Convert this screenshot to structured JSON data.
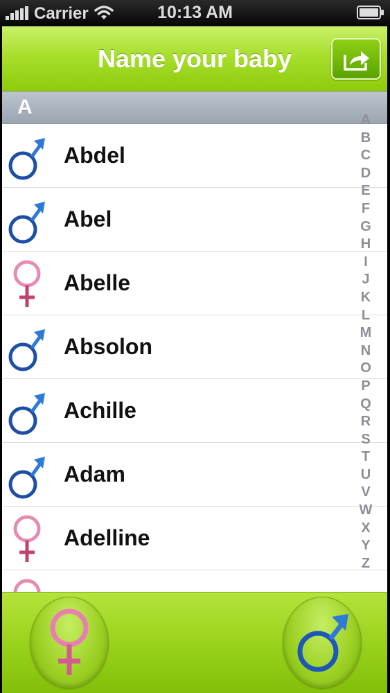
{
  "status_bar": {
    "carrier": "Carrier",
    "time": "10:13 AM",
    "icons": [
      "signal-bars-icon",
      "wifi-icon",
      "battery-icon"
    ]
  },
  "nav_bar": {
    "title": "Name your baby",
    "share_button_icon": "share-icon"
  },
  "section": {
    "letter": "A"
  },
  "names": [
    {
      "name": "Abdel",
      "gender": "male"
    },
    {
      "name": "Abel",
      "gender": "male"
    },
    {
      "name": "Abelle",
      "gender": "female"
    },
    {
      "name": "Absolon",
      "gender": "male"
    },
    {
      "name": "Achille",
      "gender": "male"
    },
    {
      "name": "Adam",
      "gender": "male"
    },
    {
      "name": "Adelline",
      "gender": "female"
    },
    {
      "name": "",
      "gender": "female"
    }
  ],
  "index": [
    "A",
    "B",
    "C",
    "D",
    "E",
    "F",
    "G",
    "H",
    "I",
    "J",
    "K",
    "L",
    "M",
    "N",
    "O",
    "P",
    "Q",
    "R",
    "S",
    "T",
    "U",
    "V",
    "W",
    "X",
    "Y",
    "Z"
  ],
  "tab_bar": {
    "female_button_icon": "female-symbol-icon",
    "male_button_icon": "male-symbol-icon"
  },
  "colors": {
    "accent_green": "#9ad31c",
    "male_blue": "#1d4fa8",
    "female_pink": "#d0558e"
  }
}
